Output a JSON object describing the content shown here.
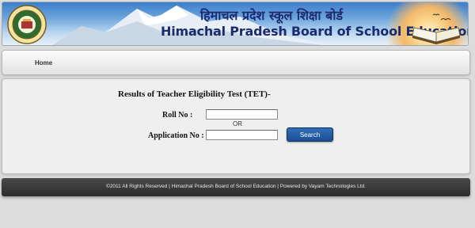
{
  "header": {
    "title_hindi": "हिमाचल प्रदेश स्कूल शिक्षा बोर्ड",
    "title_english": "Himachal Pradesh Board of School Education"
  },
  "nav": {
    "home_label": "Home"
  },
  "form": {
    "title": "Results of Teacher Eligibility Test (TET)-",
    "roll_label": "Roll No :",
    "roll_value": "",
    "or_text": "OR",
    "application_label": "Application No :",
    "application_value": "",
    "search_label": "Search"
  },
  "footer": {
    "text": "©2011 All Rights Reserved | Himachal Pradesh Board of School Education | Powered by Vayam Technologies Ltd."
  },
  "colors": {
    "title_text": "#1b2b6e",
    "search_button": "#1d4f92",
    "footer_bg": "#2b2b2b"
  }
}
